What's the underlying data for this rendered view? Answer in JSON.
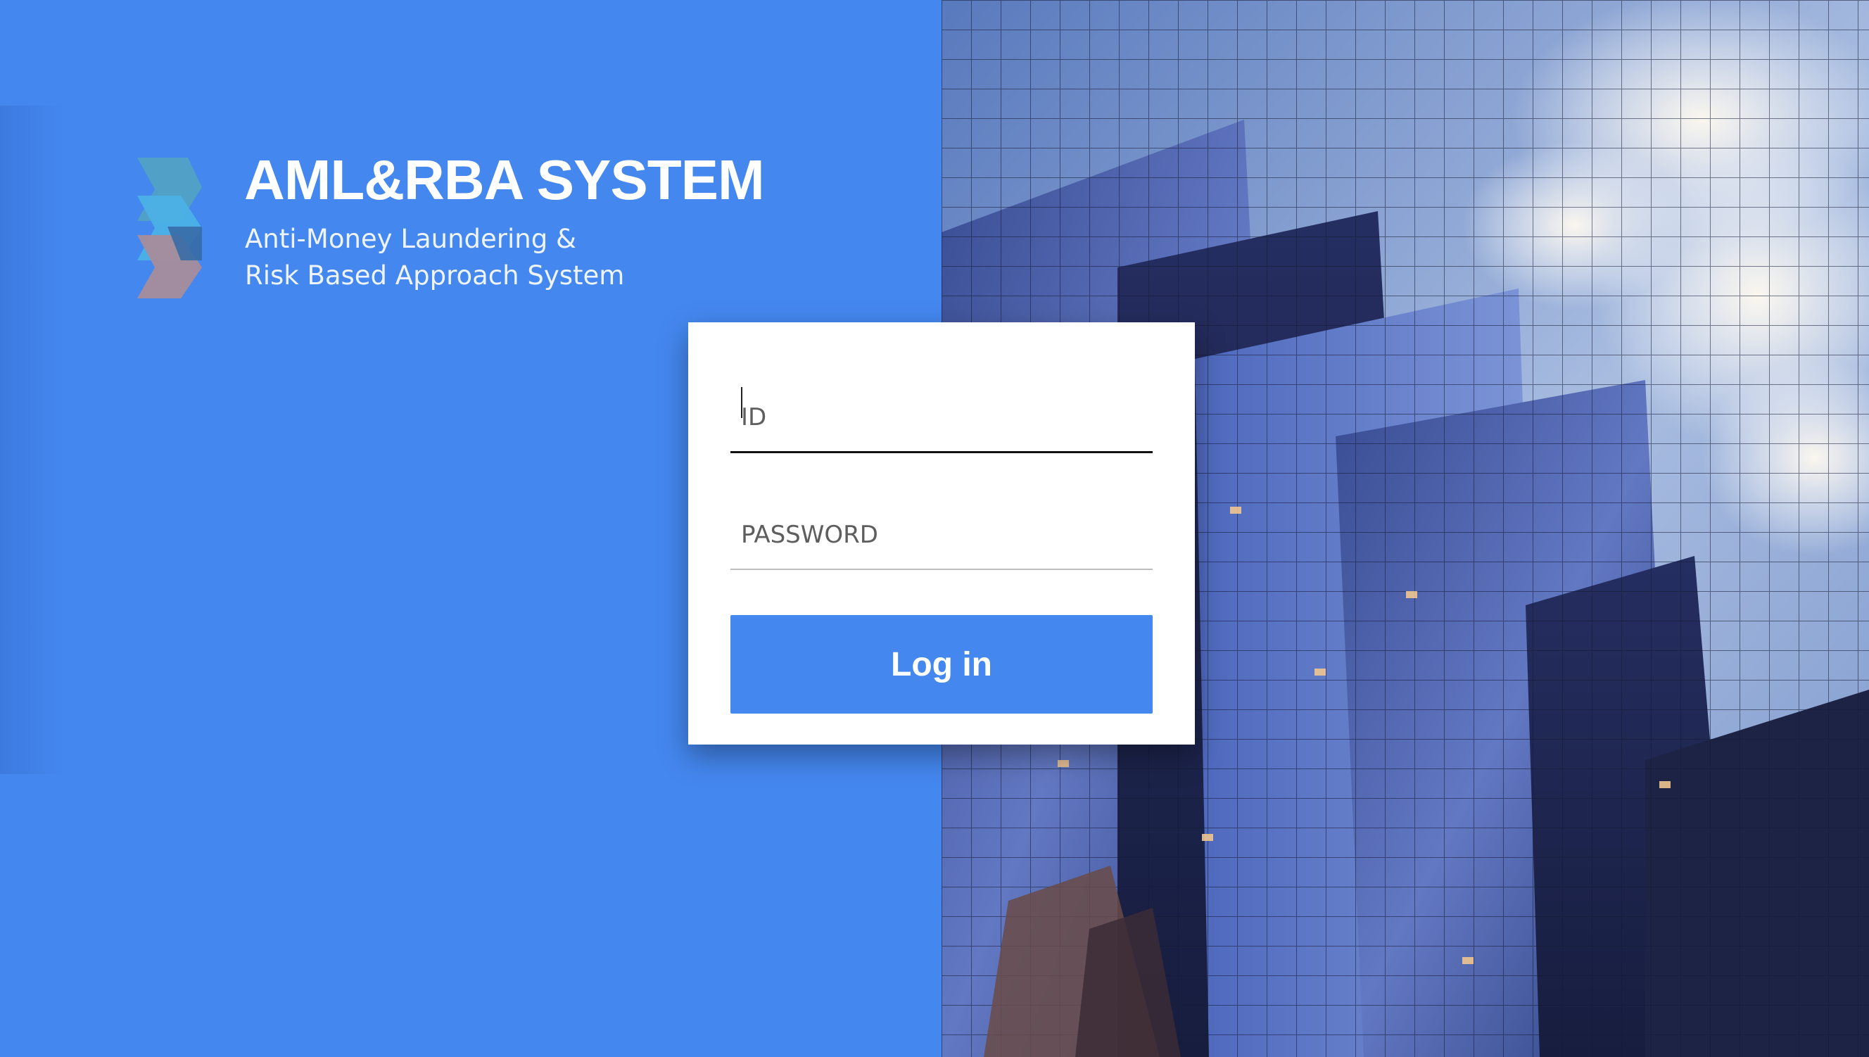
{
  "brand": {
    "title": "AML&RBA SYSTEM",
    "subtitle_line1": "Anti-Money Laundering &",
    "subtitle_line2": "Risk Based Approach System",
    "logo_icon": "layered-hexagon-logo"
  },
  "login": {
    "id_placeholder": "ID",
    "id_value": "",
    "password_placeholder": "PASSWORD",
    "password_value": "",
    "button_label": "Log in"
  },
  "background": {
    "left_color": "#4487ef",
    "photo_subject": "glass skyscraper against cloudy blue sky"
  },
  "colors": {
    "accent": "#4487ef",
    "card": "#ffffff",
    "text_on_accent": "#ffffff"
  }
}
